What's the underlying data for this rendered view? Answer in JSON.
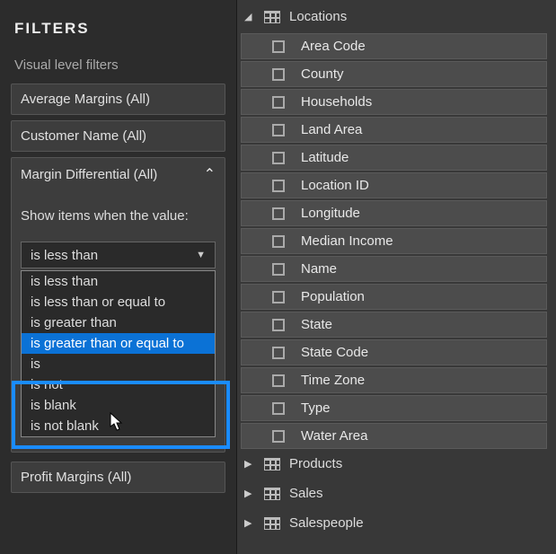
{
  "filters": {
    "title": "FILTERS",
    "subtitle": "Visual level filters",
    "cards": {
      "avg_margins": "Average Margins  (All)",
      "customer_name": "Customer Name  (All)",
      "margin_diff": "Margin Differential  (All)",
      "profit_margins": "Profit Margins  (All)"
    },
    "show_items_label": "Show items when the value:",
    "selected_option": "is less than",
    "options": [
      "is less than",
      "is less than or equal to",
      "is greater than",
      "is greater than or equal to",
      "is",
      "is not",
      "is blank",
      "is not blank"
    ]
  },
  "fields": {
    "tables": [
      {
        "name": "Locations",
        "expanded": true,
        "columns": [
          "Area Code",
          "County",
          "Households",
          "Land Area",
          "Latitude",
          "Location ID",
          "Longitude",
          "Median Income",
          "Name",
          "Population",
          "State",
          "State Code",
          "Time Zone",
          "Type",
          "Water Area"
        ]
      },
      {
        "name": "Products",
        "expanded": false,
        "columns": []
      },
      {
        "name": "Sales",
        "expanded": false,
        "columns": []
      },
      {
        "name": "Salespeople",
        "expanded": false,
        "columns": []
      }
    ]
  }
}
